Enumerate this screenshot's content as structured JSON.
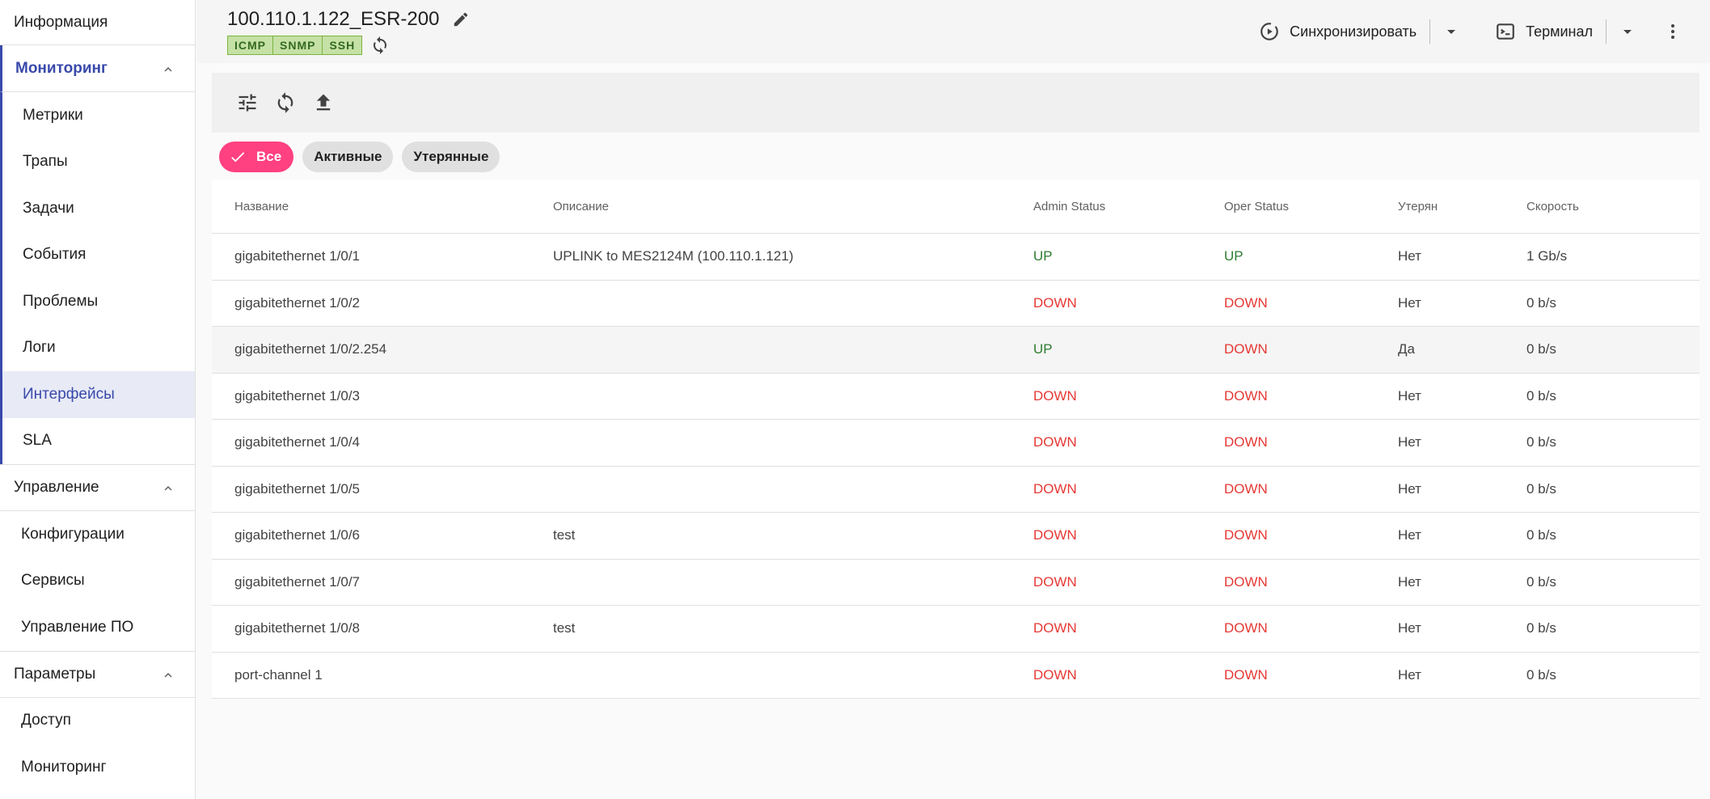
{
  "sidebar": {
    "top_item": "Информация",
    "groups": [
      {
        "label": "Мониторинг",
        "items": [
          "Метрики",
          "Трапы",
          "Задачи",
          "События",
          "Проблемы",
          "Логи",
          "Интерфейсы",
          "SLA"
        ]
      },
      {
        "label": "Управление",
        "items": [
          "Конфигурации",
          "Сервисы",
          "Управление ПО"
        ]
      },
      {
        "label": "Параметры",
        "items": [
          "Доступ",
          "Мониторинг"
        ]
      }
    ],
    "selected_item": "Интерфейсы"
  },
  "header": {
    "title": "100.110.1.122_ESR-200",
    "badges": [
      "ICMP",
      "SNMP",
      "SSH"
    ],
    "sync_label": "Синхронизировать",
    "terminal_label": "Терминал"
  },
  "chips": {
    "all": "Все",
    "active": "Активные",
    "lost": "Утерянные"
  },
  "table": {
    "columns": [
      "Название",
      "Описание",
      "Admin Status",
      "Oper Status",
      "Утерян",
      "Скорость"
    ],
    "rows": [
      {
        "name": "gigabitethernet 1/0/1",
        "desc": "UPLINK to MES2124M (100.110.1.121)",
        "admin": "UP",
        "oper": "UP",
        "lost": "Нет",
        "speed": "1 Gb/s"
      },
      {
        "name": "gigabitethernet 1/0/2",
        "desc": "",
        "admin": "DOWN",
        "oper": "DOWN",
        "lost": "Нет",
        "speed": "0 b/s"
      },
      {
        "name": "gigabitethernet 1/0/2.254",
        "desc": "",
        "admin": "UP",
        "oper": "DOWN",
        "lost": "Да",
        "speed": "0 b/s"
      },
      {
        "name": "gigabitethernet 1/0/3",
        "desc": "",
        "admin": "DOWN",
        "oper": "DOWN",
        "lost": "Нет",
        "speed": "0 b/s"
      },
      {
        "name": "gigabitethernet 1/0/4",
        "desc": "",
        "admin": "DOWN",
        "oper": "DOWN",
        "lost": "Нет",
        "speed": "0 b/s"
      },
      {
        "name": "gigabitethernet 1/0/5",
        "desc": "",
        "admin": "DOWN",
        "oper": "DOWN",
        "lost": "Нет",
        "speed": "0 b/s"
      },
      {
        "name": "gigabitethernet 1/0/6",
        "desc": "test",
        "admin": "DOWN",
        "oper": "DOWN",
        "lost": "Нет",
        "speed": "0 b/s"
      },
      {
        "name": "gigabitethernet 1/0/7",
        "desc": "",
        "admin": "DOWN",
        "oper": "DOWN",
        "lost": "Нет",
        "speed": "0 b/s"
      },
      {
        "name": "gigabitethernet 1/0/8",
        "desc": "test",
        "admin": "DOWN",
        "oper": "DOWN",
        "lost": "Нет",
        "speed": "0 b/s"
      },
      {
        "name": "port-channel 1",
        "desc": "",
        "admin": "DOWN",
        "oper": "DOWN",
        "lost": "Нет",
        "speed": "0 b/s"
      }
    ]
  },
  "colors": {
    "accent": "#3949ab",
    "chip_active": "#ff4081",
    "status_up": "#2e7d32",
    "status_down": "#e53935",
    "badge_bg": "#c5e1a5"
  }
}
